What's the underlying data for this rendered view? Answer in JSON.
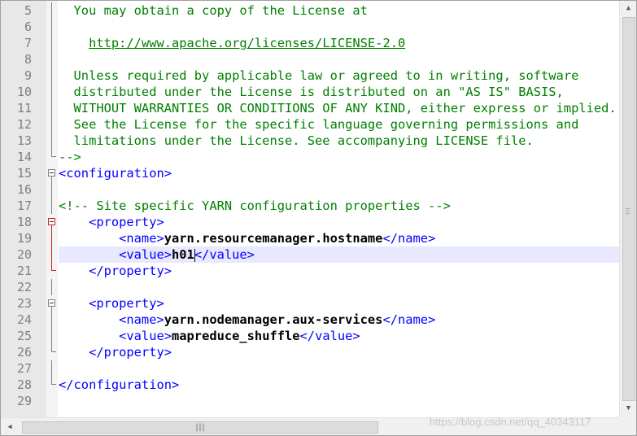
{
  "editor": {
    "lines": [
      {
        "n": "5",
        "fold": "line",
        "segments": [
          {
            "t": "  You may obtain a copy of the License at",
            "c": "comment"
          }
        ]
      },
      {
        "n": "6",
        "fold": "line",
        "segments": []
      },
      {
        "n": "7",
        "fold": "line",
        "segments": [
          {
            "t": "    ",
            "c": "comment"
          },
          {
            "t": "http://www.apache.org/licenses/LICENSE-2.0",
            "c": "url"
          }
        ]
      },
      {
        "n": "8",
        "fold": "line",
        "segments": []
      },
      {
        "n": "9",
        "fold": "line",
        "segments": [
          {
            "t": "  Unless required by applicable law or agreed to in writing, software",
            "c": "comment"
          }
        ]
      },
      {
        "n": "10",
        "fold": "line",
        "segments": [
          {
            "t": "  distributed under the License is distributed on an \"AS IS\" BASIS,",
            "c": "comment"
          }
        ]
      },
      {
        "n": "11",
        "fold": "line",
        "segments": [
          {
            "t": "  WITHOUT WARRANTIES OR CONDITIONS OF ANY KIND, either express or implied.",
            "c": "comment"
          }
        ]
      },
      {
        "n": "12",
        "fold": "line",
        "segments": [
          {
            "t": "  See the License for the specific language governing permissions and",
            "c": "comment"
          }
        ]
      },
      {
        "n": "13",
        "fold": "line",
        "segments": [
          {
            "t": "  limitations under the License. See accompanying LICENSE file.",
            "c": "comment"
          }
        ]
      },
      {
        "n": "14",
        "fold": "end",
        "segments": [
          {
            "t": "-->",
            "c": "comment"
          }
        ]
      },
      {
        "n": "15",
        "fold": "open",
        "segments": [
          {
            "t": "<configuration>",
            "c": "tag"
          }
        ]
      },
      {
        "n": "16",
        "fold": "line",
        "segments": []
      },
      {
        "n": "17",
        "fold": "line",
        "segments": [
          {
            "t": "<!-- Site specific YARN configuration properties -->",
            "c": "comment"
          }
        ]
      },
      {
        "n": "18",
        "fold": "open-red",
        "segments": [
          {
            "t": "    <property>",
            "c": "tag"
          }
        ]
      },
      {
        "n": "19",
        "fold": "line-red",
        "segments": [
          {
            "t": "        <name>",
            "c": "tag"
          },
          {
            "t": "yarn.resourcemanager.hostname",
            "c": "val"
          },
          {
            "t": "</name>",
            "c": "tag"
          }
        ]
      },
      {
        "n": "20",
        "fold": "line-red",
        "current": true,
        "segments": [
          {
            "t": "        <value>",
            "c": "tag"
          },
          {
            "t": "h01",
            "c": "val"
          },
          {
            "caret": true
          },
          {
            "t": "</value>",
            "c": "tag"
          }
        ]
      },
      {
        "n": "21",
        "fold": "end-red",
        "segments": [
          {
            "t": "    </property>",
            "c": "tag"
          }
        ]
      },
      {
        "n": "22",
        "fold": "line",
        "segments": []
      },
      {
        "n": "23",
        "fold": "open",
        "segments": [
          {
            "t": "    <property>",
            "c": "tag"
          }
        ]
      },
      {
        "n": "24",
        "fold": "line",
        "segments": [
          {
            "t": "        <name>",
            "c": "tag"
          },
          {
            "t": "yarn.nodemanager.aux-services",
            "c": "val"
          },
          {
            "t": "</name>",
            "c": "tag"
          }
        ]
      },
      {
        "n": "25",
        "fold": "line",
        "segments": [
          {
            "t": "        <value>",
            "c": "tag"
          },
          {
            "t": "mapreduce_shuffle",
            "c": "val"
          },
          {
            "t": "</value>",
            "c": "tag"
          }
        ]
      },
      {
        "n": "26",
        "fold": "end",
        "segments": [
          {
            "t": "    </property>",
            "c": "tag"
          }
        ]
      },
      {
        "n": "27",
        "fold": "line",
        "segments": []
      },
      {
        "n": "28",
        "fold": "end",
        "segments": [
          {
            "t": "</configuration>",
            "c": "tag"
          }
        ]
      },
      {
        "n": "29",
        "fold": "none",
        "segments": []
      }
    ]
  },
  "watermark": "https://blog.csdn.net/qq_40343117",
  "colors": {
    "comment": "#008000",
    "tag": "#0000ff",
    "value": "#000000",
    "current_line": "#e8e8ff",
    "fold_marker_active": "#d02020"
  }
}
